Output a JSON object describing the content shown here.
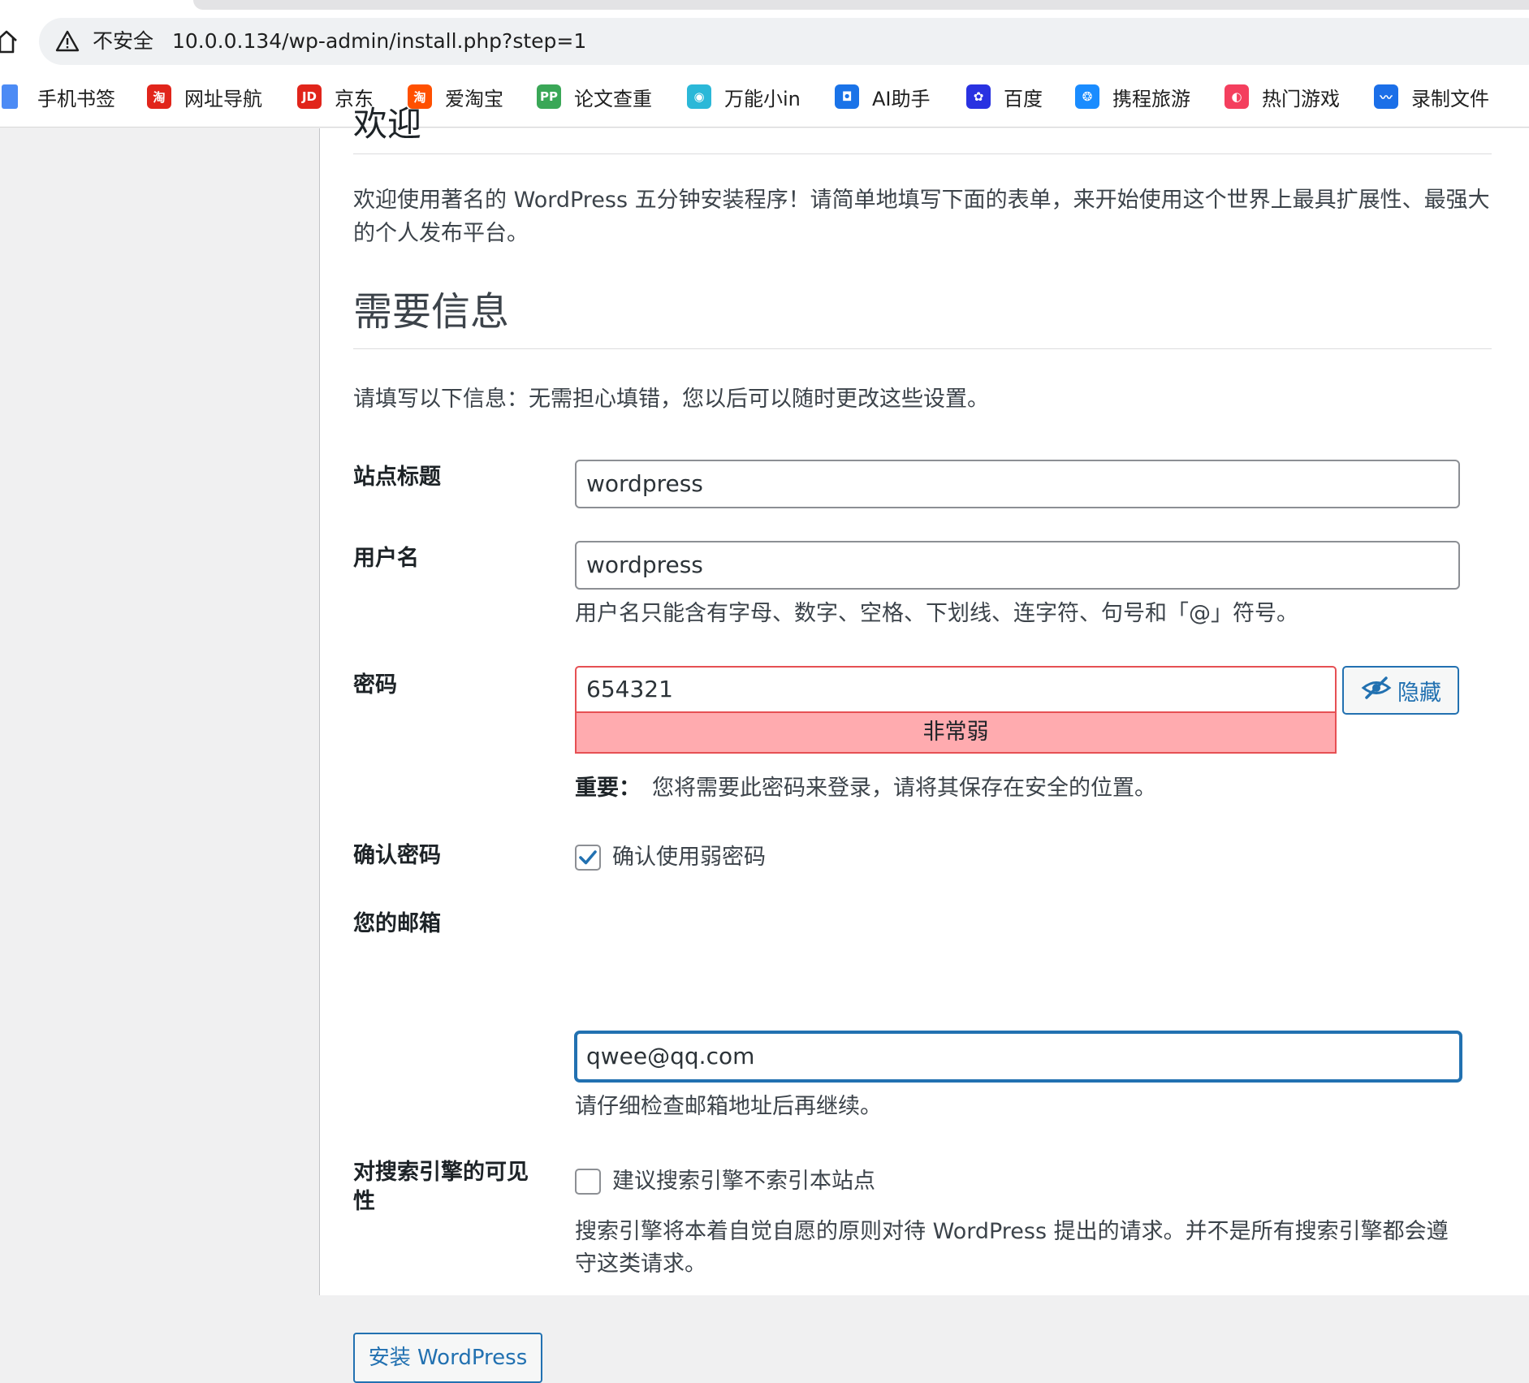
{
  "browser": {
    "security_label": "不安全",
    "url": "10.0.0.134/wp-admin/install.php?step=1",
    "bookmarks": [
      {
        "label": "手机书签",
        "icon": "mobile-bookmark-icon",
        "color": "#4c8bf5",
        "glyph": ""
      },
      {
        "label": "网址导航",
        "icon": "web-nav-icon",
        "color": "#e1251b",
        "glyph": "淘"
      },
      {
        "label": "京东",
        "icon": "jd-icon",
        "color": "#e1251b",
        "glyph": "JD"
      },
      {
        "label": "爱淘宝",
        "icon": "taobao-icon",
        "color": "#ff5000",
        "glyph": "淘"
      },
      {
        "label": "论文查重",
        "icon": "paper-check-icon",
        "color": "#3aa757",
        "glyph": "PP"
      },
      {
        "label": "万能小in",
        "icon": "robot-icon",
        "color": "#2bb8d8",
        "glyph": "◉"
      },
      {
        "label": "AI助手",
        "icon": "ai-assistant-icon",
        "color": "#1a73e8",
        "glyph": "◘"
      },
      {
        "label": "百度",
        "icon": "baidu-paw-icon",
        "color": "#2932e1",
        "glyph": "✿"
      },
      {
        "label": "携程旅游",
        "icon": "ctrip-dolphin-icon",
        "color": "#1a8cff",
        "glyph": "❂"
      },
      {
        "label": "热门游戏",
        "icon": "game-icon",
        "color": "#f43f5e",
        "glyph": "◐"
      },
      {
        "label": "录制文件",
        "icon": "record-files-icon",
        "color": "#1b6fe8",
        "glyph": "〰"
      }
    ]
  },
  "page": {
    "welcome_heading": "欢迎",
    "welcome_text": "欢迎使用著名的 WordPress 五分钟安装程序！请简单地填写下面的表单，来开始使用这个世界上最具扩展性、最强大的个人发布平台。",
    "info_heading": "需要信息",
    "info_intro": "请填写以下信息：无需担心填错，您以后可以随时更改这些设置。",
    "site_title_label": "站点标题",
    "site_title_value": "wordpress",
    "username_label": "用户名",
    "username_value": "wordpress",
    "username_hint": "用户名只能含有字母、数字、空格、下划线、连字符、句号和「@」符号。",
    "password_label": "密码",
    "password_value": "654321",
    "password_strength": "非常弱",
    "hide_button": "隐藏",
    "important_label": "重要：",
    "important_text": "您将需要此密码来登录，请将其保存在安全的位置。",
    "confirm_label": "确认密码",
    "confirm_checkbox_label": "确认使用弱密码",
    "confirm_checked": true,
    "email_label": "您的邮箱",
    "email_value": "qwee@qq.com",
    "email_hint": "请仔细检查邮箱地址后再继续。",
    "search_label": "对搜索引擎的可见性",
    "search_checkbox_label": "建议搜索引擎不索引本站点",
    "search_checked": false,
    "search_hint": "搜索引擎将本着自觉自愿的原则对待 WordPress 提出的请求。并不是所有搜索引擎都会遵守这类请求。",
    "install_button": "安装 WordPress"
  },
  "colors": {
    "accent": "#2271b1",
    "weak_bg": "#ffabaf",
    "weak_border": "#e65054"
  }
}
